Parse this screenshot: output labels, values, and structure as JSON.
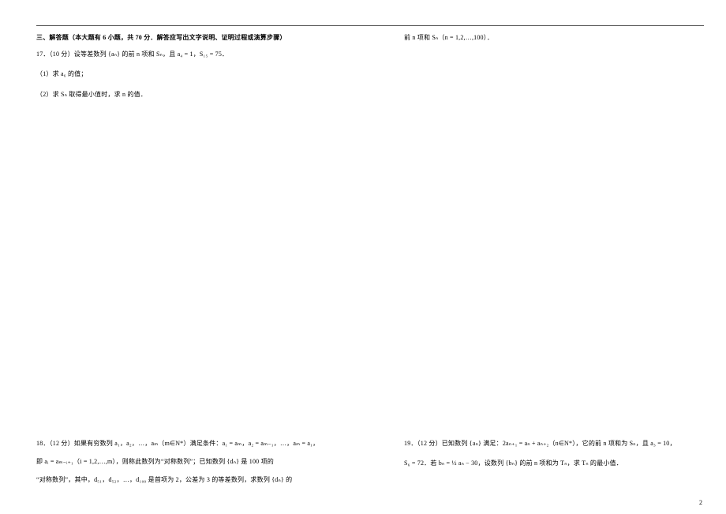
{
  "header": {
    "section_title": "三、解答题（本大题有 6 小题，共 70 分．解答应写出文字说明、证明过程或演算步骤）"
  },
  "q17": {
    "stem": "17．（10 分）设等差数列 {aₙ} 的前 n 项和 Sₙ，且 a₄ = 1，S₁₅ = 75．",
    "part1": "（1）求 a₆ 的值；",
    "part2": "（2）求 Sₙ 取得最小值时，求 n 的值．"
  },
  "q18": {
    "line1": "18．（12 分）如果有穷数列 a₁，a₂，…，aₘ（m∈N*）满足条件：a₁ = aₘ，a₂ = aₘ₋₁，…，aₘ = a₁，",
    "line2": "即 aᵢ = aₘ₋ᵢ₊₁（i = 1,2,…,m），则称此数列为“对称数列”；已知数列 {dₙ} 是 100 项的",
    "line3": "“对称数列”，其中，d₅₁，d₅₂，…，d₁₀₀ 是首项为 2，公差为 3 的等差数列，求数列 {dₙ} 的",
    "line4_right": "前 n 项和 Sₙ（n = 1,2,…,100）．"
  },
  "q19": {
    "line1": "19．（12 分）已知数列 {aₙ} 满足：2aₙ₊₁ = aₙ + aₙ₊₂（n∈N*），它的前 n 项和为 Sₙ，且 a₃ = 10，",
    "line2": "S₆ = 72．若 bₙ = ½ aₙ − 30，设数列 {bₙ} 的前 n 项和为 Tₙ，求 Tₙ 的最小值．"
  },
  "page": {
    "number": "2"
  }
}
